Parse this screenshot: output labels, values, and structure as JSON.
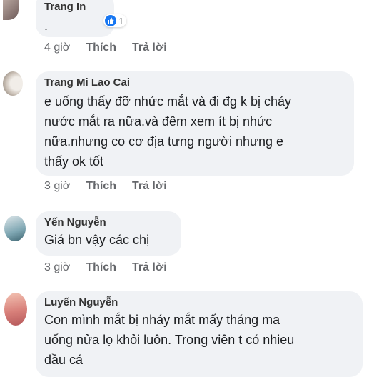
{
  "comments": [
    {
      "author": "Trang In",
      "text": ".",
      "time": "4 giờ",
      "like": "Thích",
      "reply": "Trả lời",
      "reaction_count": "1"
    },
    {
      "author": "Trang Mi Lao Cai",
      "lines": [
        "e uống thấy đỡ nhức mắt và đi đg k bị chảy",
        "nước mắt ra nữa.và đêm xem ít bị nhức",
        "nữa.nhưng co cơ địa tưng người nhưng e",
        "thấy ok tốt"
      ],
      "time": "3 giờ",
      "like": "Thích",
      "reply": "Trả lời"
    },
    {
      "author": "Yến Nguyễn",
      "text": "Giá bn vậy các chị",
      "time": "3 giờ",
      "like": "Thích",
      "reply": "Trả lời"
    },
    {
      "author": "Luyến Nguyễn",
      "lines": [
        "Con mình mắt bị nháy  mắt mấy tháng ma",
        "uống nửa lọ khỏi luôn. Trong viên t có nhieu",
        "dầu cá"
      ]
    }
  ],
  "colors": {
    "bubble": "#f0f2f5",
    "meta": "#65676b",
    "like_blue": "#1877f2"
  }
}
